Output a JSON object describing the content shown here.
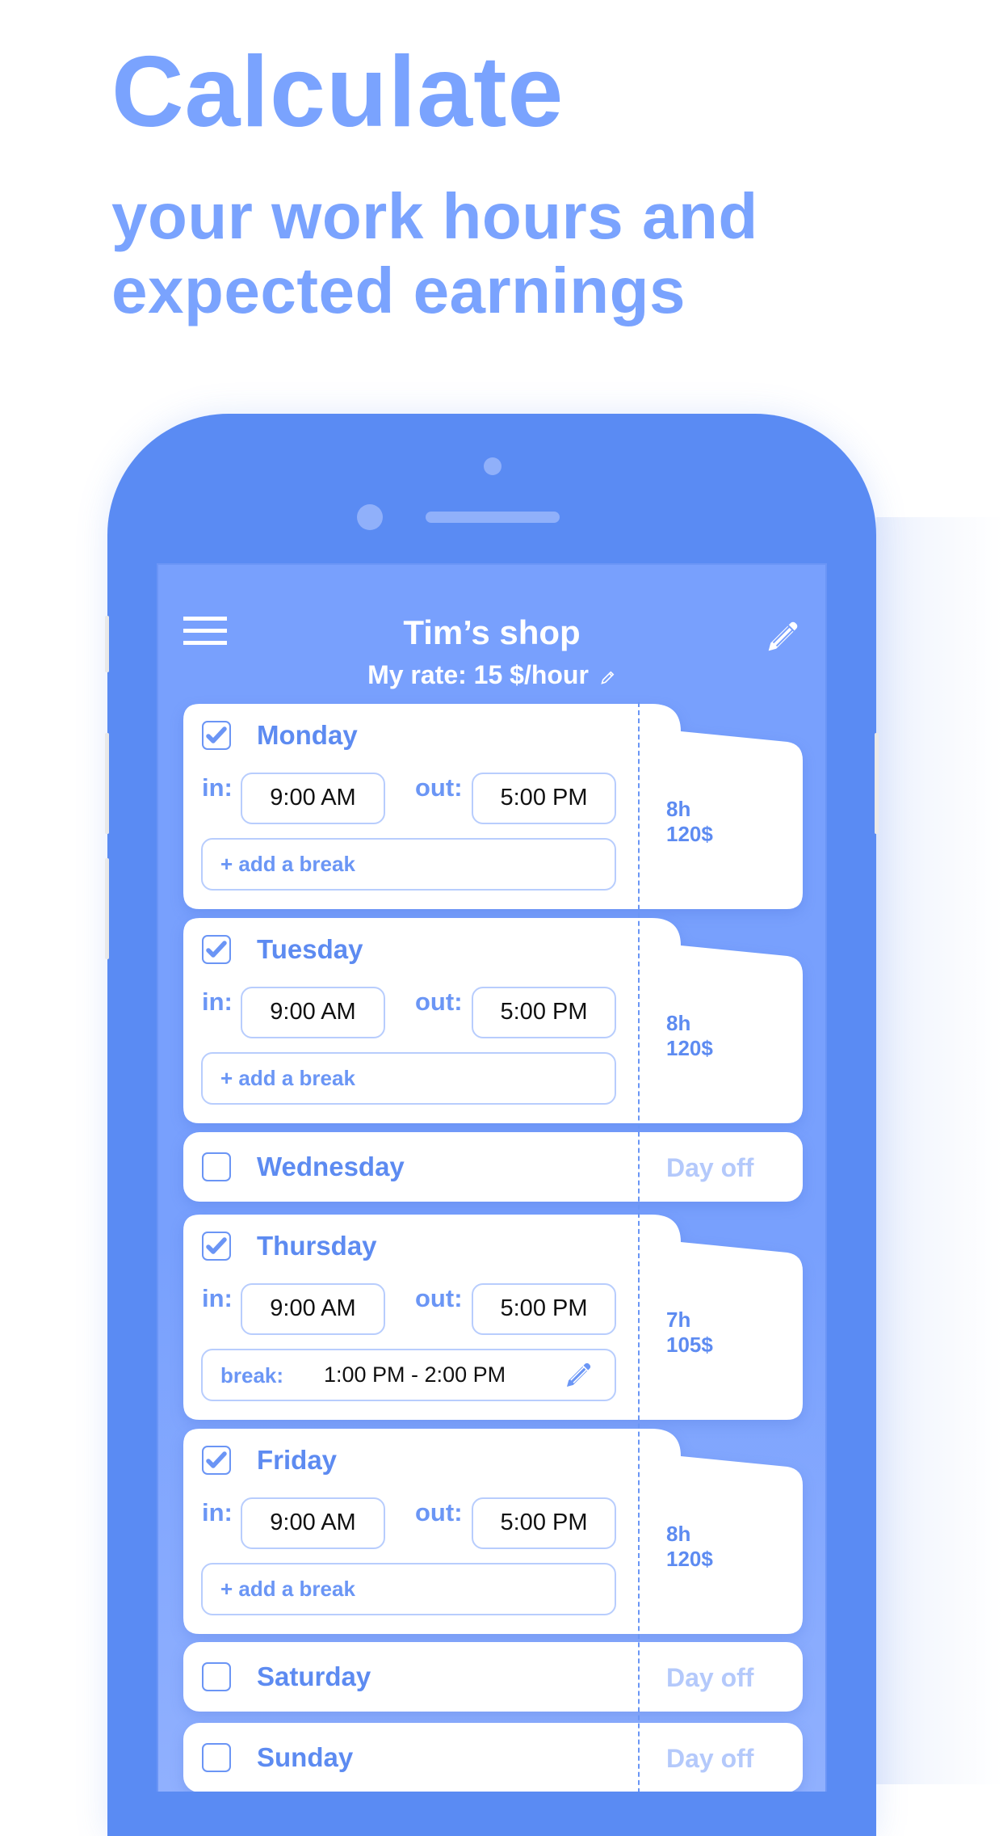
{
  "promo": {
    "headline": "Calculate",
    "subheadline_line1": "your work hours and",
    "subheadline_line2": "expected earnings",
    "accent_color": "#7aa3fe"
  },
  "app": {
    "title": "Tim’s shop",
    "rate_text": "My rate: 15 $/hour",
    "menu_icon": "hamburger-menu-icon",
    "edit_icon": "pencil-icon",
    "colors": {
      "phone_body": "#5a8bf3",
      "screen_bg": "#78a0fd",
      "primary_text": "#5d8bf1",
      "muted_text": "#b4c9fb",
      "field_border": "#b8cdfd"
    }
  },
  "days": [
    {
      "name": "Monday",
      "checked": true,
      "in_label": "in:",
      "in": "9:00 AM",
      "out_label": "out:",
      "out": "5:00 PM",
      "break_type": "add",
      "break_label": "+ add a break",
      "hours": "8h",
      "earnings": "120$"
    },
    {
      "name": "Tuesday",
      "checked": true,
      "in_label": "in:",
      "in": "9:00 AM",
      "out_label": "out:",
      "out": "5:00 PM",
      "break_type": "add",
      "break_label": "+ add a break",
      "hours": "8h",
      "earnings": "120$"
    },
    {
      "name": "Wednesday",
      "checked": false,
      "status": "Day off"
    },
    {
      "name": "Thursday",
      "checked": true,
      "in_label": "in:",
      "in": "9:00 AM",
      "out_label": "out:",
      "out": "5:00 PM",
      "break_type": "set",
      "break_label": "break:",
      "break_value": "1:00 PM - 2:00 PM",
      "hours": "7h",
      "earnings": "105$"
    },
    {
      "name": "Friday",
      "checked": true,
      "in_label": "in:",
      "in": "9:00 AM",
      "out_label": "out:",
      "out": "5:00 PM",
      "break_type": "add",
      "break_label": "+ add a break",
      "hours": "8h",
      "earnings": "120$"
    },
    {
      "name": "Saturday",
      "checked": false,
      "status": "Day off"
    },
    {
      "name": "Sunday",
      "checked": false,
      "status": "Day off"
    }
  ]
}
